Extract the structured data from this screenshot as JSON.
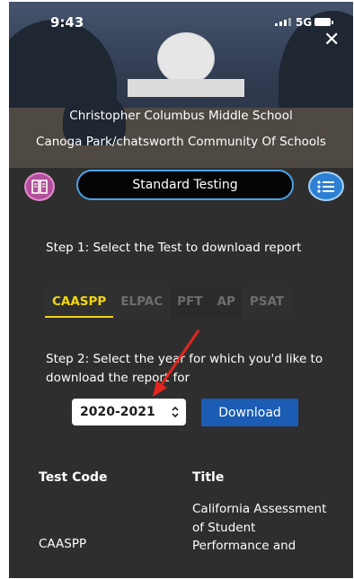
{
  "status_bar": {
    "time": "9:43",
    "network": "5G"
  },
  "profile": {
    "school_name": "Christopher Columbus Middle School",
    "community": "Canoga Park/chatsworth Community Of Schools"
  },
  "nav": {
    "active_tab_label": "Standard Testing"
  },
  "step1": {
    "label": "Step 1: Select the Test to download report",
    "tests": [
      "CAASPP",
      "ELPAC",
      "PFT",
      "AP",
      "PSAT"
    ],
    "selected_test": "CAASPP"
  },
  "step2": {
    "label": "Step 2: Select the year for which you'd like to download the report for",
    "year_selected": "2020-2021",
    "download_label": "Download"
  },
  "table": {
    "headers": {
      "code": "Test Code",
      "title": "Title"
    },
    "rows": [
      {
        "code": "CAASPP",
        "title": "California Assessment of Student Performance and"
      }
    ]
  },
  "colors": {
    "accent_yellow": "#f2d50f",
    "download_blue": "#1b5cb4",
    "annotation_arrow": "#e3261c"
  },
  "icons": {
    "book": "book-icon",
    "list": "list-icon",
    "close": "close-icon",
    "chevron": "updown-chevron-icon"
  }
}
